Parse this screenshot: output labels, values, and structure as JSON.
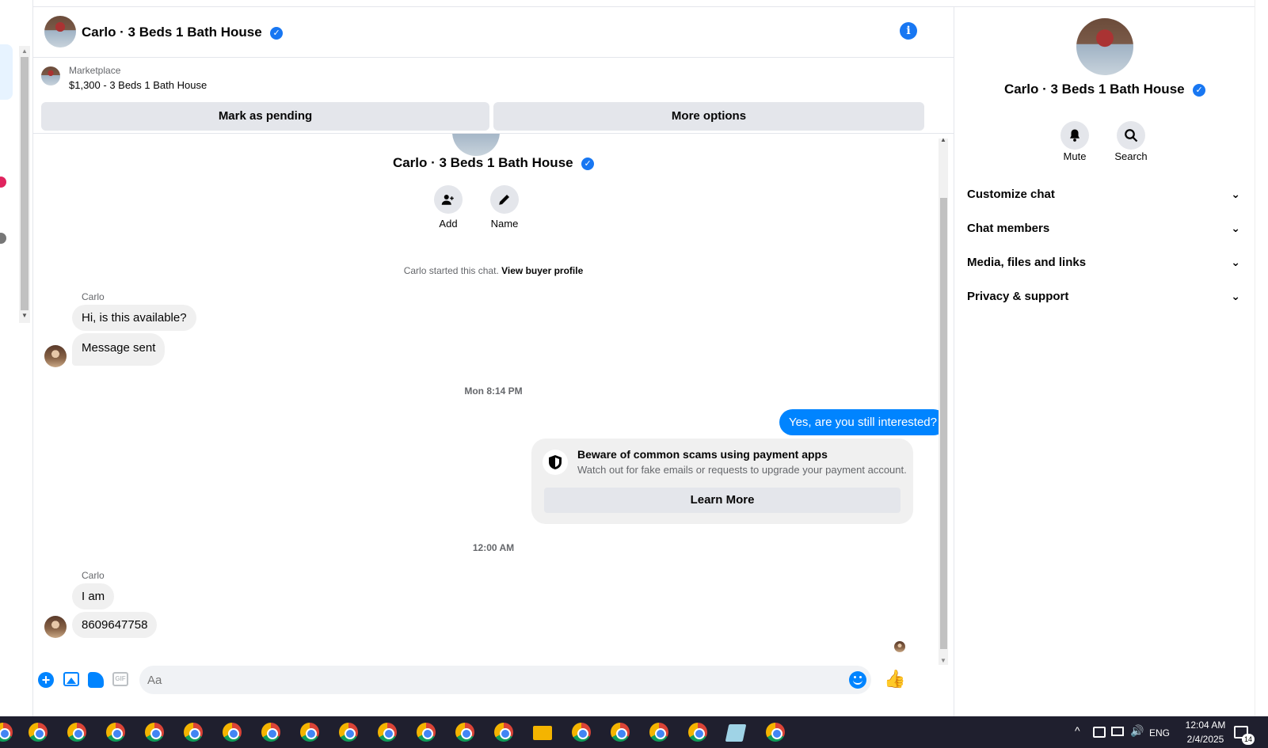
{
  "header": {
    "title": "Carlo · 3 Beds 1 Bath House"
  },
  "listing": {
    "source": "Marketplace",
    "item": "$1,300 - 3 Beds 1 Bath House",
    "mark_pending": "Mark as pending",
    "more_options": "More options"
  },
  "profile": {
    "name": "Carlo · 3 Beds 1 Bath House",
    "add_label": "Add",
    "name_label": "Name",
    "started_text": "Carlo started this chat.",
    "view_profile": "View buyer profile"
  },
  "messages": {
    "sender1": "Carlo",
    "m1": "Hi, is this available?",
    "m2": "Message sent",
    "ts1": "Mon 8:14 PM",
    "m3": "Yes, are you still interested?",
    "scam_title": "Beware of common scams using payment apps",
    "scam_body": "Watch out for fake emails or requests to upgrade your payment account.",
    "learn_more": "Learn More",
    "ts2": "12:00 AM",
    "sender2": "Carlo",
    "m4": "I am",
    "m5": "8609647758"
  },
  "composer": {
    "placeholder": "Aa"
  },
  "right_panel": {
    "name": "Carlo · 3 Beds 1 Bath House",
    "mute": "Mute",
    "search": "Search",
    "sections": [
      "Customize chat",
      "Chat members",
      "Media, files and links",
      "Privacy & support"
    ]
  },
  "taskbar": {
    "lang": "ENG",
    "time": "12:04 AM",
    "date": "2/4/2025",
    "notif_count": "14"
  },
  "colors": {
    "accent": "#0084ff",
    "brand": "#1877f2"
  }
}
